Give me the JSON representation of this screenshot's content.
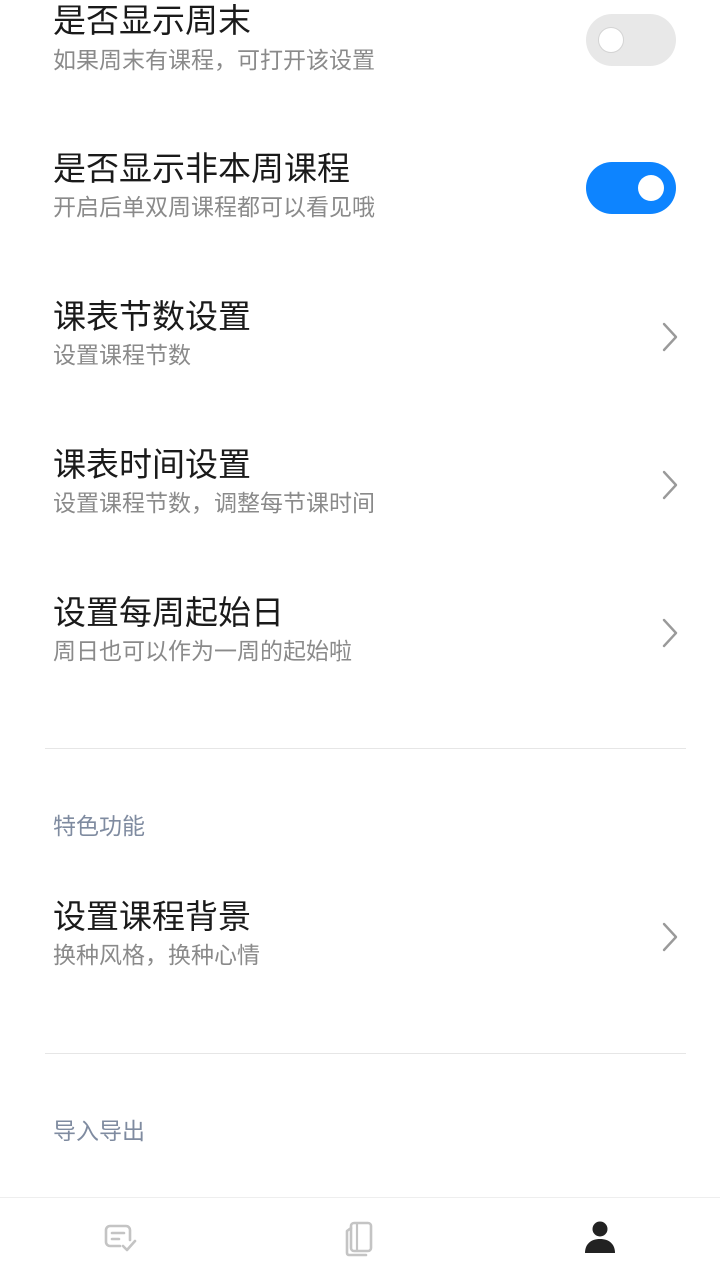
{
  "settings": {
    "items": [
      {
        "title": "是否显示周末",
        "subtitle": "如果周末有课程，可打开该设置",
        "control": "toggle",
        "on": false
      },
      {
        "title": "是否显示非本周课程",
        "subtitle": "开启后单双周课程都可以看见哦",
        "control": "toggle",
        "on": true
      },
      {
        "title": "课表节数设置",
        "subtitle": "设置课程节数",
        "control": "chevron"
      },
      {
        "title": "课表时间设置",
        "subtitle": "设置课程节数，调整每节课时间",
        "control": "chevron"
      },
      {
        "title": "设置每周起始日",
        "subtitle": "周日也可以作为一周的起始啦",
        "control": "chevron"
      }
    ]
  },
  "features": {
    "header": "特色功能",
    "items": [
      {
        "title": "设置课程背景",
        "subtitle": "换种风格，换种心情",
        "control": "chevron"
      }
    ]
  },
  "import_export": {
    "header": "导入导出"
  },
  "bottom_nav": {
    "items": [
      {
        "icon": "schedule-check-icon",
        "active": false
      },
      {
        "icon": "notebook-icon",
        "active": false
      },
      {
        "icon": "user-icon",
        "active": true
      }
    ]
  },
  "colors": {
    "toggle_on": "#0d84ff",
    "toggle_off": "#e8e8e8",
    "section_header": "#7f8ba0",
    "nav_inactive": "#c4c4c4",
    "nav_active": "#222222"
  }
}
